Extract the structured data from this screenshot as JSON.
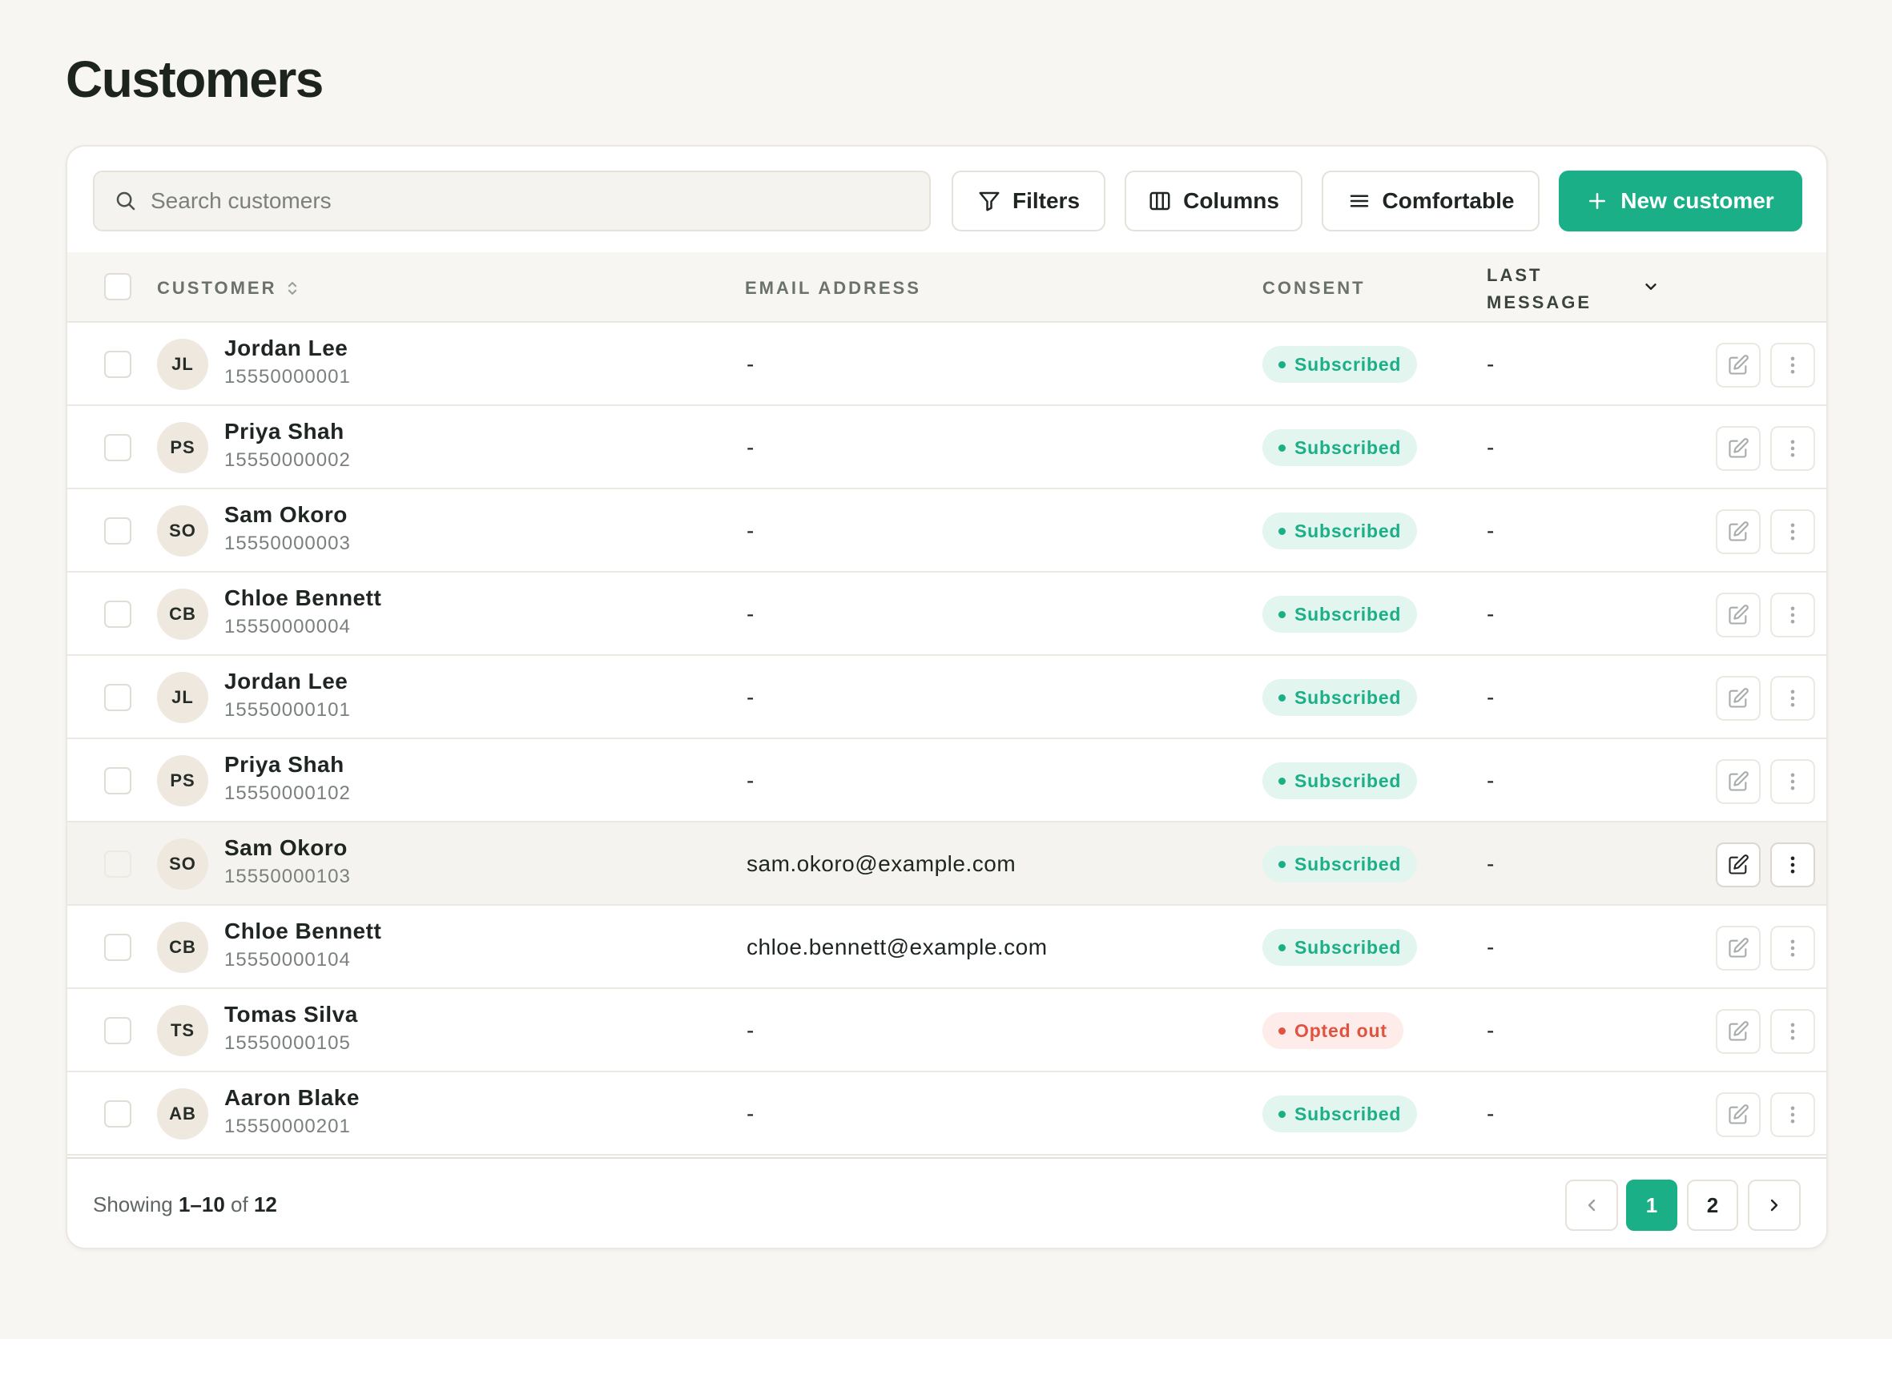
{
  "page": {
    "title": "Customers"
  },
  "toolbar": {
    "search_placeholder": "Search customers",
    "filters_label": "Filters",
    "columns_label": "Columns",
    "density_label": "Comfortable",
    "new_label": "New customer"
  },
  "table": {
    "headers": {
      "customer": "CUSTOMER",
      "email": "EMAIL ADDRESS",
      "consent": "CONSENT",
      "last_line1": "LAST",
      "last_line2": "MESSAGE"
    },
    "rows": [
      {
        "initials": "JL",
        "name": "Jordan Lee",
        "phone": "15550000001",
        "email": "-",
        "consent": "Subscribed",
        "consent_state": "subscribed",
        "last_message": "-"
      },
      {
        "initials": "PS",
        "name": "Priya Shah",
        "phone": "15550000002",
        "email": "-",
        "consent": "Subscribed",
        "consent_state": "subscribed",
        "last_message": "-"
      },
      {
        "initials": "SO",
        "name": "Sam Okoro",
        "phone": "15550000003",
        "email": "-",
        "consent": "Subscribed",
        "consent_state": "subscribed",
        "last_message": "-"
      },
      {
        "initials": "CB",
        "name": "Chloe Bennett",
        "phone": "15550000004",
        "email": "-",
        "consent": "Subscribed",
        "consent_state": "subscribed",
        "last_message": "-"
      },
      {
        "initials": "JL",
        "name": "Jordan Lee",
        "phone": "15550000101",
        "email": "-",
        "consent": "Subscribed",
        "consent_state": "subscribed",
        "last_message": "-"
      },
      {
        "initials": "PS",
        "name": "Priya Shah",
        "phone": "15550000102",
        "email": "-",
        "consent": "Subscribed",
        "consent_state": "subscribed",
        "last_message": "-"
      },
      {
        "initials": "SO",
        "name": "Sam Okoro",
        "phone": "15550000103",
        "email": "sam.okoro@example.com",
        "consent": "Subscribed",
        "consent_state": "subscribed",
        "last_message": "-"
      },
      {
        "initials": "CB",
        "name": "Chloe Bennett",
        "phone": "15550000104",
        "email": "chloe.bennett@example.com",
        "consent": "Subscribed",
        "consent_state": "subscribed",
        "last_message": "-"
      },
      {
        "initials": "TS",
        "name": "Tomas Silva",
        "phone": "15550000105",
        "email": "-",
        "consent": "Opted out",
        "consent_state": "opted-out",
        "last_message": "-"
      },
      {
        "initials": "AB",
        "name": "Aaron Blake",
        "phone": "15550000201",
        "email": "-",
        "consent": "Subscribed",
        "consent_state": "subscribed",
        "last_message": "-"
      }
    ]
  },
  "footer": {
    "showing_prefix": "Showing",
    "range": "1–10",
    "of_word": "of",
    "total": "12",
    "pages": [
      "1",
      "2"
    ],
    "current_page": "1"
  },
  "colors": {
    "accent": "#1aaf86",
    "subscribed_bg": "#e3f5ef",
    "opted_out": "#e0533f",
    "page_bg": "#f8f6f2"
  },
  "icons": {
    "search": "search-icon",
    "filters": "filter-icon",
    "columns": "columns-icon",
    "density": "menu-lines-icon",
    "new": "plus-icon",
    "edit": "edit-icon",
    "more": "more-vertical-icon"
  }
}
